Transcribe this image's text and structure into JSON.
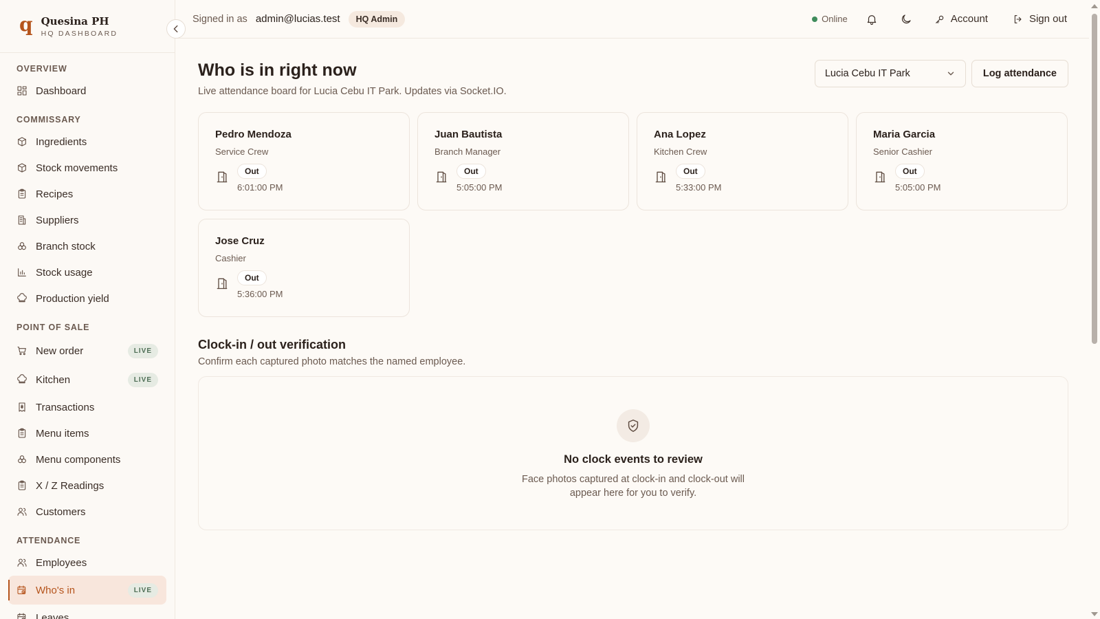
{
  "brand": {
    "logo": "q",
    "name": "Quesina PH",
    "subtitle": "HQ DASHBOARD"
  },
  "header": {
    "signed_in_label": "Signed in as",
    "email": "admin@lucias.test",
    "role": "HQ Admin",
    "status": "Online",
    "account_label": "Account",
    "signout_label": "Sign out"
  },
  "sidebar": {
    "sections": [
      {
        "title": "OVERVIEW",
        "items": [
          {
            "label": "Dashboard",
            "icon": "dashboard-icon"
          }
        ]
      },
      {
        "title": "COMMISSARY",
        "items": [
          {
            "label": "Ingredients",
            "icon": "box-icon"
          },
          {
            "label": "Stock movements",
            "icon": "box-icon"
          },
          {
            "label": "Recipes",
            "icon": "clipboard-icon"
          },
          {
            "label": "Suppliers",
            "icon": "building-icon"
          },
          {
            "label": "Branch stock",
            "icon": "boxes-icon"
          },
          {
            "label": "Stock usage",
            "icon": "bar-chart-icon"
          },
          {
            "label": "Production yield",
            "icon": "chef-hat-icon"
          }
        ]
      },
      {
        "title": "POINT OF SALE",
        "items": [
          {
            "label": "New order",
            "icon": "cart-icon",
            "badge": "LIVE"
          },
          {
            "label": "Kitchen",
            "icon": "chef-hat-icon",
            "badge": "LIVE"
          },
          {
            "label": "Transactions",
            "icon": "receipt-icon"
          },
          {
            "label": "Menu items",
            "icon": "clipboard-icon"
          },
          {
            "label": "Menu components",
            "icon": "boxes-icon"
          },
          {
            "label": "X / Z Readings",
            "icon": "clipboard-icon"
          },
          {
            "label": "Customers",
            "icon": "users-icon"
          }
        ]
      },
      {
        "title": "ATTENDANCE",
        "items": [
          {
            "label": "Employees",
            "icon": "users-icon"
          },
          {
            "label": "Who's in",
            "icon": "calendar-clock-icon",
            "badge": "LIVE",
            "active": true
          },
          {
            "label": "Leaves",
            "icon": "calendar-clock-icon"
          }
        ]
      }
    ]
  },
  "main": {
    "title": "Who is in right now",
    "subtitle": "Live attendance board for Lucia Cebu IT Park. Updates via Socket.IO.",
    "branch_select": "Lucia Cebu IT Park",
    "log_button": "Log attendance",
    "employees": [
      {
        "name": "Pedro Mendoza",
        "role": "Service Crew",
        "status": "Out",
        "time": "6:01:00 PM"
      },
      {
        "name": "Juan Bautista",
        "role": "Branch Manager",
        "status": "Out",
        "time": "5:05:00 PM"
      },
      {
        "name": "Ana Lopez",
        "role": "Kitchen Crew",
        "status": "Out",
        "time": "5:33:00 PM"
      },
      {
        "name": "Maria Garcia",
        "role": "Senior Cashier",
        "status": "Out",
        "time": "5:05:00 PM"
      },
      {
        "name": "Jose Cruz",
        "role": "Cashier",
        "status": "Out",
        "time": "5:36:00 PM"
      }
    ],
    "verification": {
      "title": "Clock-in / out verification",
      "subtitle": "Confirm each captured photo matches the named employee.",
      "empty_title": "No clock events to review",
      "empty_desc": "Face photos captured at clock-in and clock-out will appear here for you to verify."
    }
  },
  "colors": {
    "accent": "#b5541c",
    "active_bg": "#f8e6dc",
    "live_badge": "#e6ebe3",
    "online": "#3f8c5c"
  }
}
